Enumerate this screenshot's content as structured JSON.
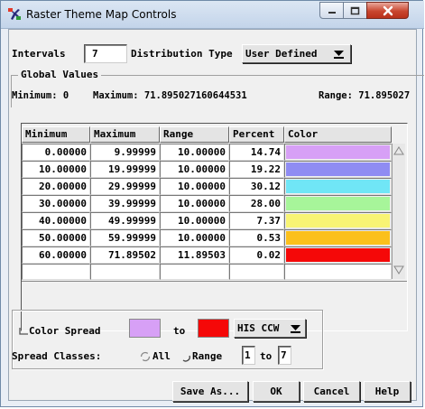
{
  "window": {
    "title": "Raster Theme Map Controls",
    "close_color": "#c9462f"
  },
  "intervals": {
    "label": "Intervals",
    "value": "7"
  },
  "distribution": {
    "label": "Distribution Type",
    "value": "User Defined"
  },
  "global": {
    "heading": "Global Values",
    "minimum": "Minimum: 0",
    "maximum": "Maximum: 71.895027160644531",
    "range": "Range: 71.895027"
  },
  "table": {
    "headers": [
      "Minimum",
      "Maximum",
      "Range",
      "Percent",
      "Color"
    ],
    "rows": [
      {
        "min": "0.00000",
        "max": "9.99999",
        "range": "10.00000",
        "pct": "14.74",
        "color": "#d7a0f6"
      },
      {
        "min": "10.00000",
        "max": "19.99999",
        "range": "10.00000",
        "pct": "19.22",
        "color": "#8f8cf3"
      },
      {
        "min": "20.00000",
        "max": "29.99999",
        "range": "10.00000",
        "pct": "30.12",
        "color": "#70e6f6"
      },
      {
        "min": "30.00000",
        "max": "39.99999",
        "range": "10.00000",
        "pct": "28.00",
        "color": "#a7f59a"
      },
      {
        "min": "40.00000",
        "max": "49.99999",
        "range": "10.00000",
        "pct": "7.37",
        "color": "#f8f474"
      },
      {
        "min": "50.00000",
        "max": "59.99999",
        "range": "10.00000",
        "pct": "0.53",
        "color": "#fbc01c"
      },
      {
        "min": "60.00000",
        "max": "71.89502",
        "range": "11.89503",
        "pct": "0.02",
        "color": "#f50808"
      }
    ]
  },
  "spread": {
    "color_spread_label": "Color Spread",
    "from_color": "#d7a0f6",
    "to_label": "to",
    "to_color": "#f50808",
    "model": "HIS CCW",
    "classes_label": "Spread Classes:",
    "all_label": "All",
    "range_label": "Range",
    "range_from": "1",
    "range_to_label": "to",
    "range_to": "7"
  },
  "buttons": {
    "save_as": "Save As...",
    "ok": "OK",
    "cancel": "Cancel",
    "help": "Help"
  }
}
